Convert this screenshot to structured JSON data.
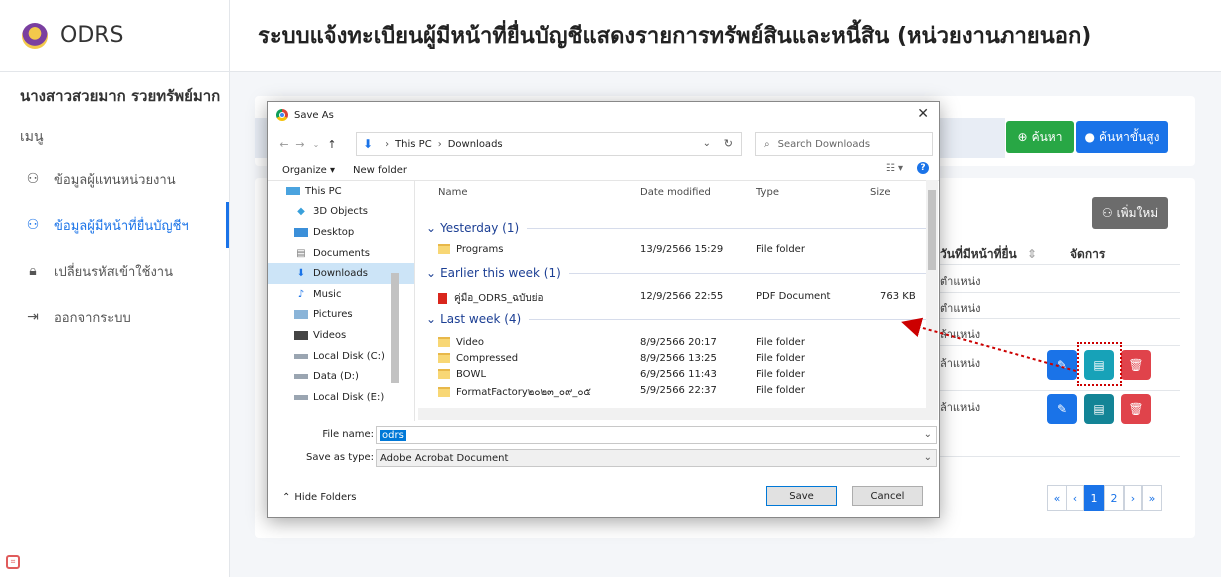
{
  "sidebar": {
    "brand": "ODRS",
    "user_name": "นางสาวสวยมาก รวยทรัพย์มาก",
    "menu_title": "เมนู",
    "items": [
      {
        "label": "ข้อมูลผู้แทนหน่วยงาน",
        "icon": "users-icon"
      },
      {
        "label": "ข้อมูลผู้มีหน้าที่ยื่นบัญชีฯ",
        "icon": "users-icon",
        "active": true
      },
      {
        "label": "เปลี่ยนรหัสเข้าใช้งาน",
        "icon": "lock-icon"
      },
      {
        "label": "ออกจากระบบ",
        "icon": "logout-icon"
      }
    ]
  },
  "header": {
    "title": "ระบบแจ้งทะเบียนผู้มีหน้าที่ยื่นบัญชีแสดงรายการทรัพย์สินและหนี้สิน (หน่วยงานภายนอก)"
  },
  "main": {
    "search_button": "ค้นหา",
    "advanced_search_button": "ค้นหาขั้นสูง",
    "add_new_button": "เพิ่มใหม่",
    "column_date": "วันที่มีหน้าที่ยื่น",
    "column_manage": "จัดการ",
    "rows": [
      {
        "position": "ตำแหน่ง"
      },
      {
        "position": "ตำแหน่ง"
      },
      {
        "position": "ล้าแหน่ง"
      },
      {
        "position": "ล้าแหน่ง"
      },
      {
        "position": "ล้าแหน่ง"
      }
    ],
    "pagination": [
      "«",
      "‹",
      "1",
      "2",
      "›",
      "»"
    ]
  },
  "dialog": {
    "title": "Save As",
    "breadcrumb": [
      "This PC",
      "Downloads"
    ],
    "search_placeholder": "Search Downloads",
    "organize": "Organize ▾",
    "new_folder": "New folder",
    "tree": [
      {
        "label": "This PC",
        "icon": "pc-icon",
        "sub": false
      },
      {
        "label": "3D Objects",
        "icon": "cube-icon",
        "sub": true
      },
      {
        "label": "Desktop",
        "icon": "desktop-icon",
        "sub": true
      },
      {
        "label": "Documents",
        "icon": "document-icon",
        "sub": true
      },
      {
        "label": "Downloads",
        "icon": "download-icon",
        "sub": true,
        "selected": true
      },
      {
        "label": "Music",
        "icon": "music-icon",
        "sub": true
      },
      {
        "label": "Pictures",
        "icon": "picture-icon",
        "sub": true
      },
      {
        "label": "Videos",
        "icon": "video-icon",
        "sub": true
      },
      {
        "label": "Local Disk (C:)",
        "icon": "disk-icon",
        "sub": true
      },
      {
        "label": "Data (D:)",
        "icon": "disk-icon",
        "sub": true
      },
      {
        "label": "Local Disk (E:)",
        "icon": "disk-icon",
        "sub": true
      }
    ],
    "columns": {
      "name": "Name",
      "date": "Date modified",
      "type": "Type",
      "size": "Size"
    },
    "groups": [
      {
        "label": "Yesterday (1)",
        "files": [
          {
            "name": "Programs",
            "date": "13/9/2566 15:29",
            "type": "File folder",
            "size": "",
            "kind": "folder"
          }
        ]
      },
      {
        "label": "Earlier this week (1)",
        "files": [
          {
            "name": "คู่มือ_ODRS_ฉบับย่อ",
            "date": "12/9/2566 22:55",
            "type": "PDF Document",
            "size": "763 KB",
            "kind": "pdf"
          }
        ]
      },
      {
        "label": "Last week (4)",
        "files": [
          {
            "name": "Video",
            "date": "8/9/2566 20:17",
            "type": "File folder",
            "size": "",
            "kind": "folder"
          },
          {
            "name": "Compressed",
            "date": "8/9/2566 13:25",
            "type": "File folder",
            "size": "",
            "kind": "folder"
          },
          {
            "name": "BOWL",
            "date": "6/9/2566 11:43",
            "type": "File folder",
            "size": "",
            "kind": "folder"
          },
          {
            "name": "FormatFactory๒๐๒๓_๐๙_๐๕",
            "date": "5/9/2566 22:37",
            "type": "File folder",
            "size": "",
            "kind": "folder"
          }
        ]
      }
    ],
    "file_name_label": "File name:",
    "file_name_value": "odrs",
    "save_type_label": "Save as type:",
    "save_type_value": "Adobe Acrobat Document",
    "hide_folders": "Hide Folders",
    "save_button": "Save",
    "cancel_button": "Cancel"
  },
  "colors": {
    "primary": "#1a73e8",
    "success": "#28a745",
    "info": "#17a2b8",
    "danger": "#e0434b",
    "annotation": "#cc0000"
  }
}
